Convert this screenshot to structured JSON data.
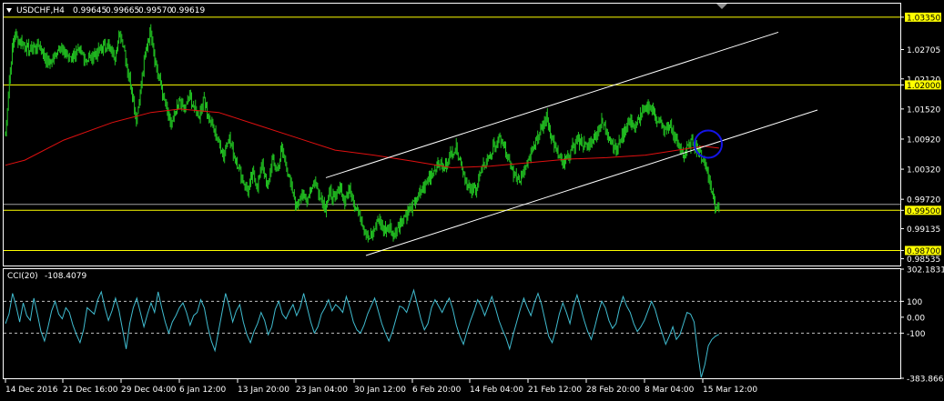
{
  "header": {
    "symbol": "USDCHF,H4",
    "open": "0.99645",
    "high": "0.99665",
    "low": "0.99570",
    "close": "0.99619"
  },
  "colors": {
    "background": "#000000",
    "frame": "#ffffff",
    "candles": "#22c422",
    "ma": "#e01010",
    "levels": "#ffff00",
    "channel": "#ffffff",
    "cci": "#40bcd0",
    "circle": "#1414e6"
  },
  "chart_data": [
    {
      "type": "candlestick",
      "symbol": "USDCHF",
      "timeframe": "H4",
      "ylim": [
        0.984,
        1.0362
      ],
      "price_ticks": [
        "1.03350",
        "1.02705",
        "1.02120",
        "1.02000",
        "1.01520",
        "1.00920",
        "1.00320",
        "0.99720",
        "0.99500",
        "0.99135",
        "0.98700",
        "0.98535"
      ],
      "highlighted_prices": [
        "1.03350",
        "1.02000",
        "0.99500",
        "0.98700"
      ],
      "current_price_marker": "0.99619",
      "horizontal_levels": [
        1.0335,
        1.02,
        0.995,
        0.987
      ],
      "time_labels": [
        "14 Dec 2016",
        "21 Dec 16:00",
        "29 Dec 04:00",
        "6 Jan 12:00",
        "13 Jan 20:00",
        "23 Jan 04:00",
        "30 Jan 12:00",
        "6 Feb 20:00",
        "14 Feb 04:00",
        "21 Feb 12:00",
        "28 Feb 20:00",
        "8 Mar 04:00",
        "15 Mar 12:00"
      ],
      "close_path": [
        [
          0,
          1.01
        ],
        [
          4,
          1.0215
        ],
        [
          9,
          1.03
        ],
        [
          16,
          1.0285
        ],
        [
          25,
          1.027
        ],
        [
          35,
          1.028
        ],
        [
          45,
          1.024
        ],
        [
          55,
          1.0275
        ],
        [
          65,
          1.0255
        ],
        [
          75,
          1.0265
        ],
        [
          85,
          1.025
        ],
        [
          95,
          1.0265
        ],
        [
          105,
          1.028
        ],
        [
          112,
          1.0255
        ],
        [
          118,
          1.03
        ],
        [
          122,
          1.028
        ],
        [
          126,
          1.023
        ],
        [
          131,
          1.018
        ],
        [
          135,
          1.013
        ],
        [
          138,
          1.017
        ],
        [
          142,
          1.023
        ],
        [
          146,
          1.028
        ],
        [
          150,
          1.031
        ],
        [
          154,
          1.025
        ],
        [
          160,
          1.02
        ],
        [
          165,
          1.016
        ],
        [
          170,
          1.012
        ],
        [
          175,
          1.014
        ],
        [
          180,
          1.017
        ],
        [
          185,
          1.015
        ],
        [
          190,
          1.018
        ],
        [
          195,
          1.015
        ],
        [
          200,
          1.014
        ],
        [
          205,
          1.0175
        ],
        [
          210,
          1.013
        ],
        [
          215,
          1.011
        ],
        [
          220,
          1.0085
        ],
        [
          225,
          1.006
        ],
        [
          230,
          1.01
        ],
        [
          235,
          1.006
        ],
        [
          240,
          1.004
        ],
        [
          245,
          1.001
        ],
        [
          250,
          0.9985
        ],
        [
          255,
          1.0025
        ],
        [
          260,
          1.0
        ],
        [
          265,
          1.0045
        ],
        [
          270,
          0.999
        ],
        [
          275,
          1.005
        ],
        [
          280,
          1.003
        ],
        [
          285,
          1.007
        ],
        [
          288,
          1.005
        ],
        [
          292,
          1.002
        ],
        [
          296,
          0.9985
        ],
        [
          300,
          0.996
        ],
        [
          305,
          0.9985
        ],
        [
          310,
          0.9965
        ],
        [
          315,
          0.9995
        ],
        [
          320,
          1.0005
        ],
        [
          325,
          0.9975
        ],
        [
          330,
          0.9955
        ],
        [
          335,
          0.9985
        ],
        [
          340,
          0.997
        ],
        [
          345,
          1.0
        ],
        [
          350,
          0.9965
        ],
        [
          355,
          0.9995
        ],
        [
          360,
          0.9965
        ],
        [
          365,
          0.994
        ],
        [
          370,
          0.9915
        ],
        [
          375,
          0.9895
        ],
        [
          380,
          0.9905
        ],
        [
          385,
          0.9935
        ],
        [
          390,
          0.991
        ],
        [
          395,
          0.992
        ],
        [
          400,
          0.99
        ],
        [
          405,
          0.992
        ],
        [
          410,
          0.9935
        ],
        [
          415,
          0.9945
        ],
        [
          420,
          0.996
        ],
        [
          425,
          0.9975
        ],
        [
          430,
          0.999
        ],
        [
          435,
          1.001
        ],
        [
          440,
          1.0025
        ],
        [
          444,
          1.0035
        ],
        [
          448,
          1.0045
        ],
        [
          452,
          1.003
        ],
        [
          456,
          1.005
        ],
        [
          460,
          1.0065
        ],
        [
          465,
          1.0075
        ],
        [
          470,
          1.0045
        ],
        [
          475,
          1.001
        ],
        [
          480,
          0.9985
        ],
        [
          485,
          0.9995
        ],
        [
          490,
          1.0025
        ],
        [
          495,
          1.0045
        ],
        [
          500,
          1.006
        ],
        [
          505,
          1.008
        ],
        [
          510,
          1.0095
        ],
        [
          515,
          1.007
        ],
        [
          520,
          1.004
        ],
        [
          525,
          1.002
        ],
        [
          530,
          1.001
        ],
        [
          535,
          1.0035
        ],
        [
          540,
          1.0055
        ],
        [
          545,
          1.0085
        ],
        [
          550,
          1.01
        ],
        [
          555,
          1.012
        ],
        [
          558,
          1.0135
        ],
        [
          562,
          1.0105
        ],
        [
          566,
          1.008
        ],
        [
          570,
          1.006
        ],
        [
          575,
          1.004
        ],
        [
          580,
          1.0055
        ],
        [
          585,
          1.0075
        ],
        [
          590,
          1.009
        ],
        [
          595,
          1.0085
        ],
        [
          600,
          1.0075
        ],
        [
          605,
          1.009
        ],
        [
          610,
          1.0105
        ],
        [
          615,
          1.0125
        ],
        [
          620,
          1.011
        ],
        [
          625,
          1.009
        ],
        [
          630,
          1.007
        ],
        [
          635,
          1.0095
        ],
        [
          640,
          1.0115
        ],
        [
          645,
          1.013
        ],
        [
          650,
          1.0115
        ],
        [
          655,
          1.014
        ],
        [
          660,
          1.015
        ],
        [
          665,
          1.016
        ],
        [
          670,
          1.014
        ],
        [
          675,
          1.0125
        ],
        [
          680,
          1.011
        ],
        [
          685,
          1.012
        ],
        [
          690,
          1.0095
        ],
        [
          695,
          1.0075
        ],
        [
          700,
          1.006
        ],
        [
          704,
          1.0075
        ],
        [
          708,
          1.009
        ],
        [
          712,
          1.008
        ],
        [
          716,
          1.0065
        ],
        [
          720,
          1.005
        ],
        [
          724,
          1.003
        ],
        [
          728,
          0.999
        ],
        [
          732,
          0.996
        ],
        [
          736,
          0.9962
        ]
      ],
      "ma_path": [
        [
          0,
          1.004
        ],
        [
          20,
          1.005
        ],
        [
          60,
          1.009
        ],
        [
          110,
          1.0125
        ],
        [
          150,
          1.0145
        ],
        [
          180,
          1.0152
        ],
        [
          220,
          1.0145
        ],
        [
          260,
          1.012
        ],
        [
          300,
          1.0095
        ],
        [
          340,
          1.007
        ],
        [
          380,
          1.006
        ],
        [
          420,
          1.0048
        ],
        [
          460,
          1.0035
        ],
        [
          500,
          1.0038
        ],
        [
          540,
          1.0045
        ],
        [
          580,
          1.0052
        ],
        [
          620,
          1.0055
        ],
        [
          660,
          1.006
        ],
        [
          700,
          1.0072
        ],
        [
          720,
          1.0078
        ],
        [
          736,
          1.0074
        ]
      ],
      "channel_lines": [
        {
          "points": [
            [
              358,
              1.0015
            ],
            [
              855,
              1.0305
            ]
          ]
        },
        {
          "points": [
            [
              402,
              0.986
            ],
            [
              898,
              1.015
            ]
          ]
        }
      ],
      "circle_marker": {
        "x": 778,
        "y": 1.0082
      }
    },
    {
      "type": "line",
      "indicator": "CCI(20)",
      "period": 20,
      "current_value": "-108.4079",
      "ylim": [
        -383.8666,
        302.1831
      ],
      "axis_labels": [
        "302.1831",
        "100",
        "0.00",
        "-100",
        "-383.8666"
      ],
      "reference_levels": [
        100,
        -100
      ],
      "values": [
        -40,
        20,
        150,
        70,
        -30,
        90,
        10,
        -20,
        120,
        20,
        -90,
        -150,
        -60,
        40,
        100,
        20,
        -10,
        60,
        30,
        -50,
        -110,
        -160,
        -80,
        60,
        40,
        20,
        110,
        160,
        60,
        -20,
        40,
        120,
        40,
        -80,
        -200,
        -40,
        60,
        120,
        30,
        -60,
        20,
        90,
        30,
        160,
        60,
        -30,
        -100,
        -30,
        10,
        60,
        90,
        30,
        -50,
        10,
        30,
        110,
        60,
        -60,
        -150,
        -210,
        -90,
        30,
        150,
        70,
        -30,
        40,
        80,
        -30,
        -110,
        -160,
        -90,
        -40,
        30,
        -20,
        -110,
        -60,
        50,
        100,
        20,
        -10,
        40,
        80,
        10,
        60,
        150,
        60,
        -30,
        -100,
        -60,
        20,
        60,
        110,
        40,
        80,
        60,
        30,
        130,
        60,
        -30,
        -80,
        -100,
        -50,
        20,
        70,
        120,
        40,
        -40,
        -100,
        -150,
        -90,
        -10,
        70,
        60,
        30,
        100,
        170,
        80,
        -10,
        -80,
        -40,
        60,
        110,
        70,
        30,
        80,
        120,
        50,
        -50,
        -120,
        -170,
        -90,
        -20,
        40,
        110,
        70,
        10,
        70,
        130,
        60,
        -20,
        -80,
        -130,
        -200,
        -110,
        -30,
        50,
        120,
        60,
        10,
        90,
        150,
        80,
        -20,
        -120,
        -160,
        -80,
        20,
        90,
        30,
        -40,
        70,
        140,
        60,
        -20,
        -90,
        -140,
        -60,
        30,
        100,
        60,
        -20,
        -70,
        -40,
        60,
        130,
        70,
        30,
        -40,
        -90,
        -60,
        -20,
        40,
        100,
        50,
        -30,
        -100,
        -170,
        -120,
        -60,
        -140,
        -110,
        -40,
        30,
        20,
        -30,
        -220,
        -380,
        -300,
        -180,
        -140,
        -120,
        -108
      ]
    }
  ]
}
